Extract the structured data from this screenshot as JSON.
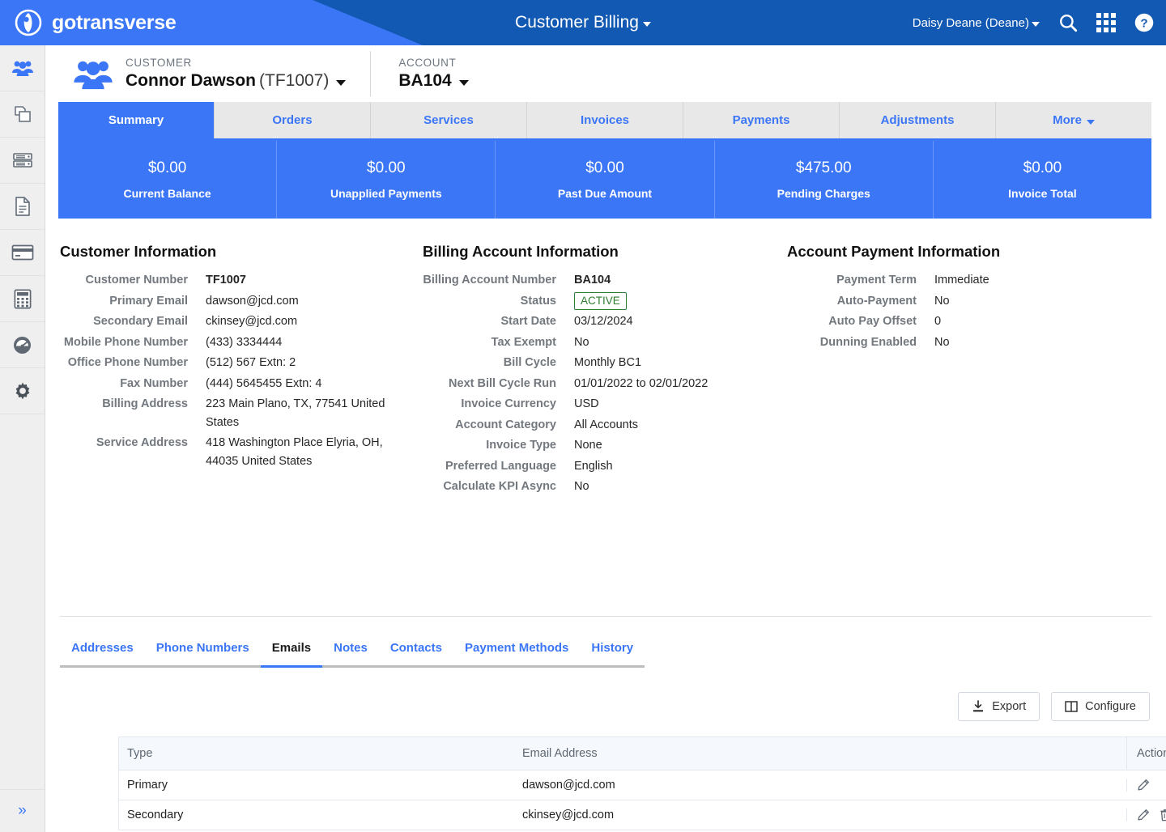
{
  "header": {
    "brand": "gotransverse",
    "brand_logo_icon": "circle-swoosh-logo",
    "app_title": "Customer Billing",
    "user": "Daisy Deane (Deane)",
    "icons": [
      "search-icon",
      "apps-grid-icon",
      "help-icon"
    ],
    "colors": {
      "wedge": "#3b76f6",
      "bar": "#1259b3"
    }
  },
  "sidebar": {
    "items": [
      {
        "icon": "customers-icon",
        "active": true
      },
      {
        "icon": "copy-documents-icon",
        "active": false
      },
      {
        "icon": "server-stack-icon",
        "active": false
      },
      {
        "icon": "document-icon",
        "active": false
      },
      {
        "icon": "credit-card-icon",
        "active": false
      },
      {
        "icon": "calculator-icon",
        "active": false
      },
      {
        "icon": "dashboard-gauge-icon",
        "active": false
      },
      {
        "icon": "settings-gear-icon",
        "active": false
      }
    ],
    "collapse_label": "»"
  },
  "context": {
    "customer_label": "CUSTOMER",
    "customer_name": "Connor Dawson",
    "customer_code": "(TF1007)",
    "account_label": "ACCOUNT",
    "account_value": "BA104"
  },
  "main_tabs": [
    {
      "label": "Summary",
      "active": true
    },
    {
      "label": "Orders",
      "active": false
    },
    {
      "label": "Services",
      "active": false
    },
    {
      "label": "Invoices",
      "active": false
    },
    {
      "label": "Payments",
      "active": false
    },
    {
      "label": "Adjustments",
      "active": false
    },
    {
      "label": "More",
      "active": false,
      "caret": true
    }
  ],
  "kpis": [
    {
      "value": "$0.00",
      "label": "Current Balance"
    },
    {
      "value": "$0.00",
      "label": "Unapplied Payments"
    },
    {
      "value": "$0.00",
      "label": "Past Due Amount"
    },
    {
      "value": "$475.00",
      "label": "Pending Charges"
    },
    {
      "value": "$0.00",
      "label": "Invoice Total"
    }
  ],
  "customer_information": {
    "title": "Customer Information",
    "rows": [
      {
        "label": "Customer Number",
        "value": "TF1007",
        "bold": true
      },
      {
        "label": "Primary Email",
        "value": "dawson@jcd.com"
      },
      {
        "label": "Secondary Email",
        "value": "ckinsey@jcd.com"
      },
      {
        "label": "Mobile Phone Number",
        "value": "(433) 3334444"
      },
      {
        "label": "Office Phone Number",
        "value": "(512) 567 Extn: 2"
      },
      {
        "label": "Fax Number",
        "value": "(444) 5645455 Extn: 4"
      },
      {
        "label": "Billing Address",
        "value": "223 Main Plano, TX, 77541 United States"
      },
      {
        "label": "Service Address",
        "value": "418 Washington Place Elyria, OH, 44035 United States"
      }
    ]
  },
  "billing_account_information": {
    "title": "Billing Account Information",
    "rows": [
      {
        "label": "Billing Account Number",
        "value": "BA104",
        "bold": true
      },
      {
        "label": "Status",
        "value": "ACTIVE",
        "badge": true
      },
      {
        "label": "Start Date",
        "value": "03/12/2024"
      },
      {
        "label": "Tax Exempt",
        "value": "No"
      },
      {
        "label": "Bill Cycle",
        "value": "Monthly BC1"
      },
      {
        "label": "Next Bill Cycle Run",
        "value": "01/01/2022 to 02/01/2022"
      },
      {
        "label": "Invoice Currency",
        "value": "USD"
      },
      {
        "label": "Account Category",
        "value": "All Accounts"
      },
      {
        "label": "Invoice Type",
        "value": "None"
      },
      {
        "label": "Preferred Language",
        "value": "English"
      },
      {
        "label": "Calculate KPI Async",
        "value": "No"
      }
    ]
  },
  "account_payment_information": {
    "title": "Account Payment Information",
    "rows": [
      {
        "label": "Payment Term",
        "value": "Immediate"
      },
      {
        "label": "Auto-Payment",
        "value": "No"
      },
      {
        "label": "Auto Pay Offset",
        "value": "0"
      },
      {
        "label": "Dunning Enabled",
        "value": "No"
      }
    ]
  },
  "sub_tabs": [
    {
      "label": "Addresses",
      "active": false
    },
    {
      "label": "Phone Numbers",
      "active": false
    },
    {
      "label": "Emails",
      "active": true
    },
    {
      "label": "Notes",
      "active": false
    },
    {
      "label": "Contacts",
      "active": false
    },
    {
      "label": "Payment Methods",
      "active": false
    },
    {
      "label": "History",
      "active": false
    }
  ],
  "toolbar": {
    "export_label": "Export",
    "configure_label": "Configure"
  },
  "table": {
    "columns": [
      "Type",
      "Email Address",
      "Actions"
    ],
    "rows": [
      {
        "type": "Primary",
        "email": "dawson@jcd.com",
        "actions": [
          "edit"
        ]
      },
      {
        "type": "Secondary",
        "email": "ckinsey@jcd.com",
        "actions": [
          "edit",
          "delete"
        ]
      }
    ]
  }
}
